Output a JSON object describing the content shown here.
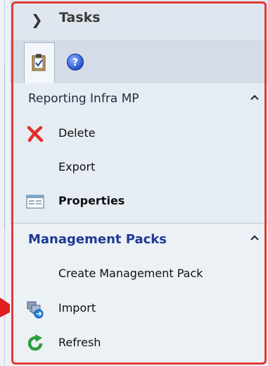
{
  "header": {
    "title": "Tasks",
    "expand_icon": "chevron-right-icon"
  },
  "tabs": [
    {
      "icon": "clipboard-check-icon",
      "active": true
    },
    {
      "icon": "help-circle-icon",
      "active": false
    }
  ],
  "sections": [
    {
      "title": "Reporting Infra MP",
      "collapse_icon": "caret-up-icon",
      "items": [
        {
          "label": "Delete",
          "icon": "delete-x-icon"
        },
        {
          "label": "Export",
          "icon": ""
        },
        {
          "label": "Properties",
          "icon": "properties-icon",
          "bold": true
        }
      ]
    },
    {
      "title": "Management Packs",
      "collapse_icon": "caret-up-icon",
      "items": [
        {
          "label": "Create Management Pack",
          "icon": ""
        },
        {
          "label": "Import",
          "icon": "import-icon"
        },
        {
          "label": "Refresh",
          "icon": "refresh-icon"
        }
      ]
    }
  ],
  "colors": {
    "accent": "#1f3a93",
    "highlight_frame": "#e53935",
    "delete_red": "#e0302a",
    "refresh_green": "#2e9e3e"
  }
}
